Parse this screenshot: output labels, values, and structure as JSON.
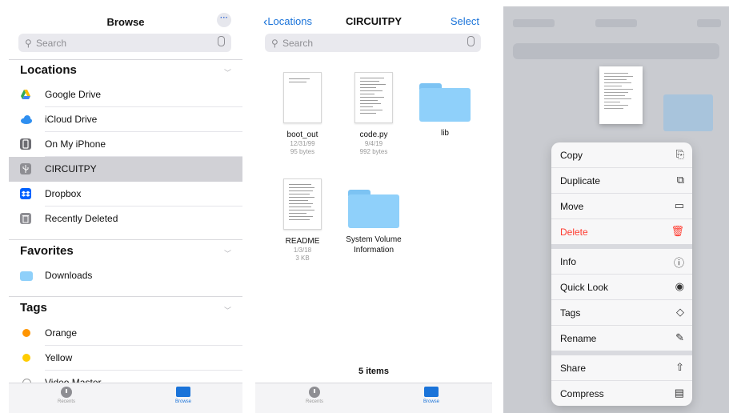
{
  "browse": {
    "title": "Browse",
    "more": "···",
    "search_placeholder": "Search",
    "locations_header": "Locations",
    "locations": [
      {
        "label": "Google Drive",
        "icon": "google-drive-icon"
      },
      {
        "label": "iCloud Drive",
        "icon": "icloud-icon"
      },
      {
        "label": "On My iPhone",
        "icon": "iphone-icon"
      },
      {
        "label": "CIRCUITPY",
        "icon": "usb-icon",
        "selected": true
      },
      {
        "label": "Dropbox",
        "icon": "dropbox-icon"
      },
      {
        "label": "Recently Deleted",
        "icon": "trash-icon"
      }
    ],
    "favorites_header": "Favorites",
    "favorites": [
      {
        "label": "Downloads",
        "icon": "folder-icon"
      }
    ],
    "tags_header": "Tags",
    "tags": [
      {
        "label": "Orange",
        "color": "#ff9500"
      },
      {
        "label": "Yellow",
        "color": "#ffcc00"
      },
      {
        "label": "Video Master",
        "color": "#ffffff"
      }
    ],
    "tabs": {
      "recents": "Recents",
      "browse": "Browse"
    }
  },
  "folder": {
    "back": "Locations",
    "title": "CIRCUITPY",
    "select": "Select",
    "search_placeholder": "Search",
    "files": [
      {
        "name": "boot_out",
        "date": "12/31/99",
        "size": "95 bytes",
        "kind": "doc"
      },
      {
        "name": "code.py",
        "date": "9/4/19",
        "size": "992 bytes",
        "kind": "doc"
      },
      {
        "name": "lib",
        "date": "",
        "size": "",
        "kind": "folder"
      },
      {
        "name": "README",
        "date": "1/3/18",
        "size": "3 KB",
        "kind": "doc"
      },
      {
        "name": "System Volume Information",
        "date": "",
        "size": "",
        "kind": "folder"
      }
    ],
    "count": "5 items",
    "tabs": {
      "recents": "Recents",
      "browse": "Browse"
    }
  },
  "context_menu": {
    "items": [
      {
        "label": "Copy",
        "icon": "copy-icon",
        "glyph": "⎘"
      },
      {
        "label": "Duplicate",
        "icon": "duplicate-icon",
        "glyph": "⧉"
      },
      {
        "label": "Move",
        "icon": "folder-icon",
        "glyph": "▭"
      },
      {
        "label": "Delete",
        "icon": "trash-icon",
        "glyph": "🗑",
        "destructive": true
      },
      {
        "label": "Info",
        "icon": "info-icon",
        "glyph": "ⓘ"
      },
      {
        "label": "Quick Look",
        "icon": "eye-icon",
        "glyph": "◉"
      },
      {
        "label": "Tags",
        "icon": "tag-icon",
        "glyph": "◇"
      },
      {
        "label": "Rename",
        "icon": "pencil-icon",
        "glyph": "✎"
      },
      {
        "label": "Share",
        "icon": "share-icon",
        "glyph": "⇧"
      },
      {
        "label": "Compress",
        "icon": "archive-icon",
        "glyph": "▤"
      }
    ]
  },
  "colors": {
    "accent": "#1a73d9",
    "destructive": "#ff3b30",
    "selected_row": "#d1d1d6"
  }
}
